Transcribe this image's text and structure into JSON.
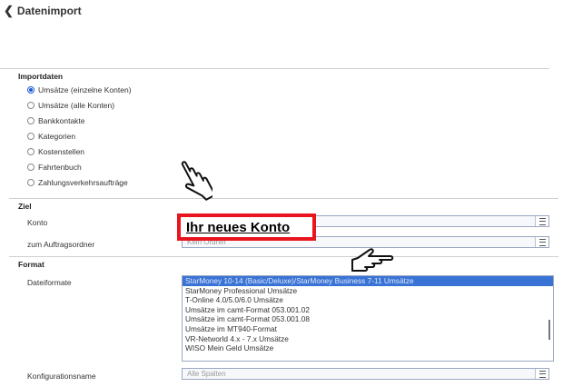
{
  "header": {
    "back_label": "Datenimport"
  },
  "importdaten": {
    "title": "Importdaten",
    "options": [
      {
        "label": "Umsätze (einzelne Konten)",
        "selected": true
      },
      {
        "label": "Umsätze (alle Konten)",
        "selected": false
      },
      {
        "label": "Bankkontakte",
        "selected": false
      },
      {
        "label": "Kategorien",
        "selected": false
      },
      {
        "label": "Kostenstellen",
        "selected": false
      },
      {
        "label": "Fahrtenbuch",
        "selected": false
      },
      {
        "label": "Zahlungsverkehrsaufträge",
        "selected": false
      }
    ]
  },
  "ziel": {
    "title": "Ziel",
    "konto_label": "Konto",
    "konto_value": "Ihr neues Konto",
    "auftragsordner_label": "zum Auftragsordner",
    "auftragsordner_value": "Kein Ordner"
  },
  "format": {
    "title": "Format",
    "dateiformate_label": "Dateiformate",
    "dateiformate": [
      {
        "label": "StarMoney 10-14 (Basic/Deluxe)/StarMoney Business 7-11 Umsätze",
        "selected": true
      },
      {
        "label": "StarMoney Professional Umsätze",
        "selected": false
      },
      {
        "label": "T-Online 4.0/5.0/6.0 Umsätze",
        "selected": false
      },
      {
        "label": "Umsätze im camt-Format 053.001.02",
        "selected": false
      },
      {
        "label": "Umsätze im camt-Format 053.001.08",
        "selected": false
      },
      {
        "label": "Umsätze im MT940-Format",
        "selected": false
      },
      {
        "label": "VR-Networld 4.x - 7.x Umsätze",
        "selected": false
      },
      {
        "label": "WISO Mein Geld Umsätze",
        "selected": false
      }
    ],
    "konfigurationsname_label": "Konfigurationsname",
    "konfigurationsname_value": "Alle Spalten"
  },
  "icons": {
    "back": "chevron-left-icon",
    "field_menu": "menu-icon",
    "pointer": "hand-pointer-icon"
  },
  "colors": {
    "highlight_border": "#e8151f",
    "selection": "#3973d6",
    "radio_accent": "#1e5bd8"
  }
}
